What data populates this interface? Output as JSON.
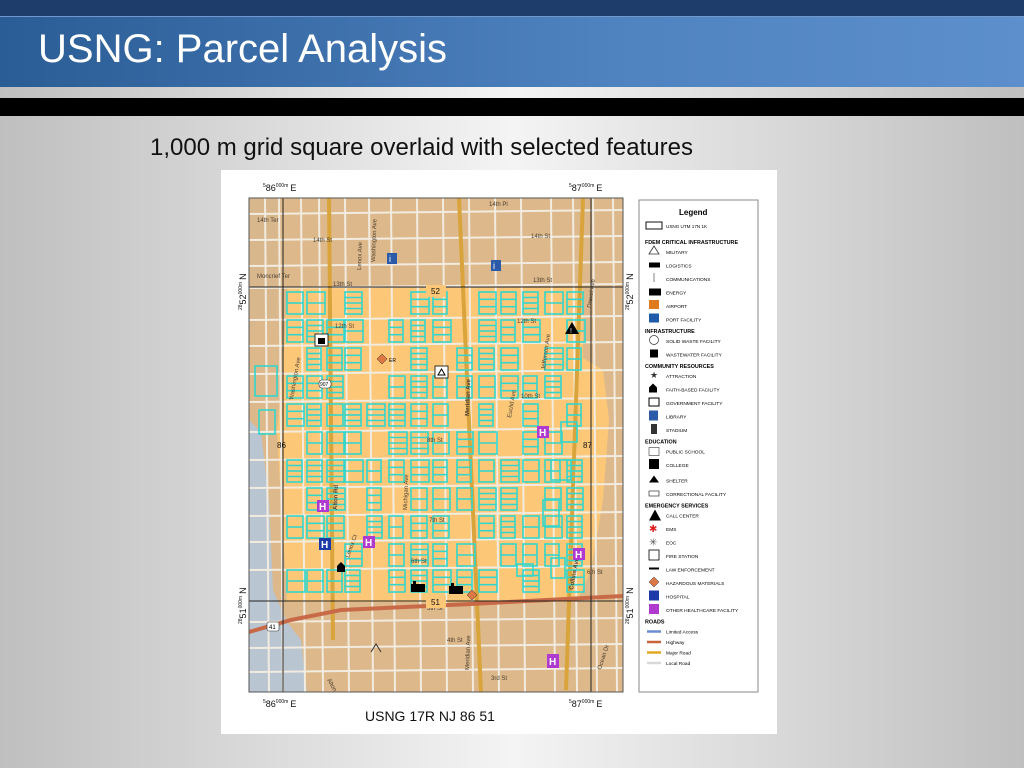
{
  "slide": {
    "title": "USNG: Parcel Analysis",
    "subtitle": "1,000 m grid square overlaid with selected features"
  },
  "map": {
    "grid_id": "USNG 17R NJ 86 51",
    "grid_top_left_label": "86",
    "grid_top_right_label": "87",
    "grid_bottom_left_label": "86",
    "grid_bottom_right_label": "87",
    "grid_left_top_label": "52",
    "grid_left_bottom_label": "51",
    "easting_superscript": "5",
    "easting_unit": "000m",
    "easting_letter": "E",
    "northing_superscript": "28",
    "northing_unit": "000m",
    "northing_letter": "N",
    "inner_labels": {
      "north": "52",
      "south": "51",
      "west": "86",
      "east": "87"
    },
    "streets": [
      "14th Pl",
      "14th Ter",
      "14th St",
      "13th St",
      "12th St",
      "11th St",
      "10th St",
      "9th St",
      "8th St",
      "7th St",
      "6th St",
      "5th St",
      "4th St",
      "3rd St",
      "Moncrief Ter",
      "Meridian Ave",
      "Lenox Ave",
      "Collins Ave",
      "Ocean Dr",
      "Drexel Ave",
      "Alton Rd",
      "Washington Ave",
      "Euclid Ave",
      "Michigan Ave",
      "Lenox Ct",
      "Jefferson Ave"
    ],
    "route_shield": "41",
    "route_shield_2": "907",
    "legend": {
      "title": "Legend",
      "grid_item": "USNG UTM 17N 1K",
      "sections": [
        {
          "heading": "FDEM CRITICAL INFRASTRUCTURE",
          "items": [
            {
              "label": "MILITARY",
              "icon": "military-icon"
            },
            {
              "label": "LOGISTICS",
              "icon": "logistics-icon"
            },
            {
              "label": "COMMUNICATIONS",
              "icon": "communications-icon"
            },
            {
              "label": "ENERGY",
              "icon": "energy-icon"
            },
            {
              "label": "AIRPORT",
              "icon": "airport-icon"
            },
            {
              "label": "PORT FACILITY",
              "icon": "port-icon"
            }
          ]
        },
        {
          "heading": "INFRASTRUCTURE",
          "items": [
            {
              "label": "SOLID WASTE FACILITY",
              "icon": "solid-waste-icon"
            },
            {
              "label": "WASTEWATER FACILITY",
              "icon": "wastewater-icon"
            }
          ]
        },
        {
          "heading": "COMMUNITY RESOURCES",
          "items": [
            {
              "label": "ATTRACTION",
              "icon": "attraction-icon"
            },
            {
              "label": "FAITH-BASED FACILITY",
              "icon": "faith-icon"
            },
            {
              "label": "GOVERNMENT FACILITY",
              "icon": "government-icon"
            },
            {
              "label": "LIBRARY",
              "icon": "library-icon"
            },
            {
              "label": "STADIUM",
              "icon": "stadium-icon"
            }
          ]
        },
        {
          "heading": "EDUCATION",
          "items": [
            {
              "label": "PUBLIC SCHOOL",
              "icon": "school-icon"
            },
            {
              "label": "COLLEGE",
              "icon": "college-icon"
            }
          ]
        },
        {
          "heading": "",
          "items": [
            {
              "label": "SHELTER",
              "icon": "shelter-icon"
            },
            {
              "label": "CORRECTIONAL FACILITY",
              "icon": "correctional-icon"
            }
          ]
        },
        {
          "heading": "EMERGENCY SERVICES",
          "items": [
            {
              "label": "CALL CENTER",
              "icon": "call-center-icon"
            },
            {
              "label": "EMS",
              "icon": "ems-icon"
            },
            {
              "label": "EOC",
              "icon": "eoc-icon"
            },
            {
              "label": "FIRE STATION",
              "icon": "fire-station-icon"
            },
            {
              "label": "LAW ENFORCEMENT",
              "icon": "law-icon"
            },
            {
              "label": "HAZARDOUS MATERIALS",
              "icon": "hazmat-icon"
            },
            {
              "label": "HOSPITAL",
              "icon": "hospital-icon"
            },
            {
              "label": "OTHER HEALTHCARE FACILITY",
              "icon": "other-health-icon"
            }
          ]
        },
        {
          "heading": "ROADS",
          "items": [
            {
              "label": "Limited Access",
              "icon": "limited-access-line",
              "color": "#6a8ed0"
            },
            {
              "label": "Highway",
              "icon": "highway-line",
              "color": "#c8643c"
            },
            {
              "label": "Major Road",
              "icon": "major-road-line",
              "color": "#e0a824"
            },
            {
              "label": "Local Road",
              "icon": "local-road-line",
              "color": "#d8d8d8"
            }
          ]
        }
      ]
    },
    "colors": {
      "land": "#dcb88a",
      "focus_area": "#fcc878",
      "water": "#b9c5d1",
      "parcel": "#33d6cc",
      "road_local": "#f2ebe0",
      "road_major": "#d9a43c",
      "road_highway": "#c86a48",
      "grid": "#222222"
    }
  }
}
